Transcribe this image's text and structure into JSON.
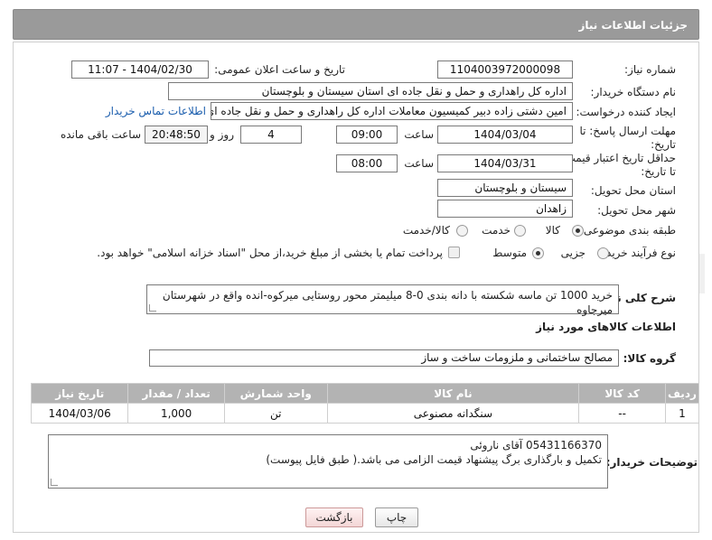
{
  "header": {
    "title": "جزئیات اطلاعات نیاز"
  },
  "form": {
    "need_number": {
      "label": "شماره نیاز:",
      "value": "1104003972000098"
    },
    "announce": {
      "label": "تاریخ و ساعت اعلان عمومی:",
      "value": "1404/02/30 - 11:07"
    },
    "buyer_org": {
      "label": "نام دستگاه خریدار:",
      "value": "اداره کل راهداری و حمل و نقل جاده ای استان سیستان و بلوچستان"
    },
    "creator": {
      "label": "ایجاد کننده درخواست:",
      "value": "امین دشتی زاده دبیر کمیسیون معاملات اداره کل راهداری و حمل و نقل جاده ای",
      "contact_link": "اطلاعات تماس خریدار"
    },
    "deadline": {
      "label_line1": "مهلت ارسال پاسخ: تا",
      "label_line2": "تاریخ:",
      "date": "1404/03/04",
      "time_label": "ساعت",
      "time": "09:00",
      "days": "4",
      "days_label": "روز و",
      "remaining": "20:48:50",
      "remaining_label": "ساعت باقی مانده"
    },
    "price_validity": {
      "label_line1": "حداقل تاریخ اعتبار قیمت:",
      "label_line2": "تا تاریخ:",
      "date": "1404/03/31",
      "time_label": "ساعت",
      "time": "08:00"
    },
    "delivery_province": {
      "label": "استان محل تحویل:",
      "value": "سیستان و بلوچستان"
    },
    "delivery_city": {
      "label": "شهر محل تحویل:",
      "value": "زاهدان"
    },
    "category": {
      "label": "طبقه بندی موضوعی:",
      "options": [
        "کالا",
        "خدمت",
        "کالا/خدمت"
      ],
      "selected": "کالا"
    },
    "process": {
      "label": "نوع فرآیند خرید :",
      "options": [
        "جزیی",
        "متوسط"
      ],
      "selected": "متوسط",
      "payment_note": "پرداخت تمام یا بخشی از مبلغ خرید،از محل \"اسناد خزانه اسلامی\" خواهد بود."
    },
    "description": {
      "label": "شرح کلی نیاز:",
      "value": "خرید 1000 تن ماسه شکسته با دانه بندی 0-8 میلیمتر محور روستایی میرکوه-انده واقع در شهرستان میرجاوه"
    },
    "goods_section_title": "اطلاعات کالاهای مورد نیاز",
    "goods_group": {
      "label": "گروه کالا:",
      "value": "مصالح ساختمانی و ملزومات ساخت و ساز"
    }
  },
  "table": {
    "headers": [
      "ردیف",
      "کد کالا",
      "نام کالا",
      "واحد شمارش",
      "تعداد / مقدار",
      "تاریخ نیاز"
    ],
    "rows": [
      [
        "1",
        "--",
        "سنگدانه مصنوعی",
        "تن",
        "1,000",
        "1404/03/06"
      ]
    ]
  },
  "buyer_notes": {
    "label": "توضیحات خریدار:",
    "line1": "05431166370 آقای ناروئی",
    "line2": "تکمیل و بارگذاری برگ پیشنهاد قیمت الزامی می باشد.( طبق فایل پیوست)"
  },
  "buttons": {
    "print": "چاپ",
    "back": "بازگشت"
  },
  "colors": {
    "header_bg": "#9a9a9a",
    "table_header_bg": "#b3b3b3",
    "link": "#1a5dad"
  }
}
